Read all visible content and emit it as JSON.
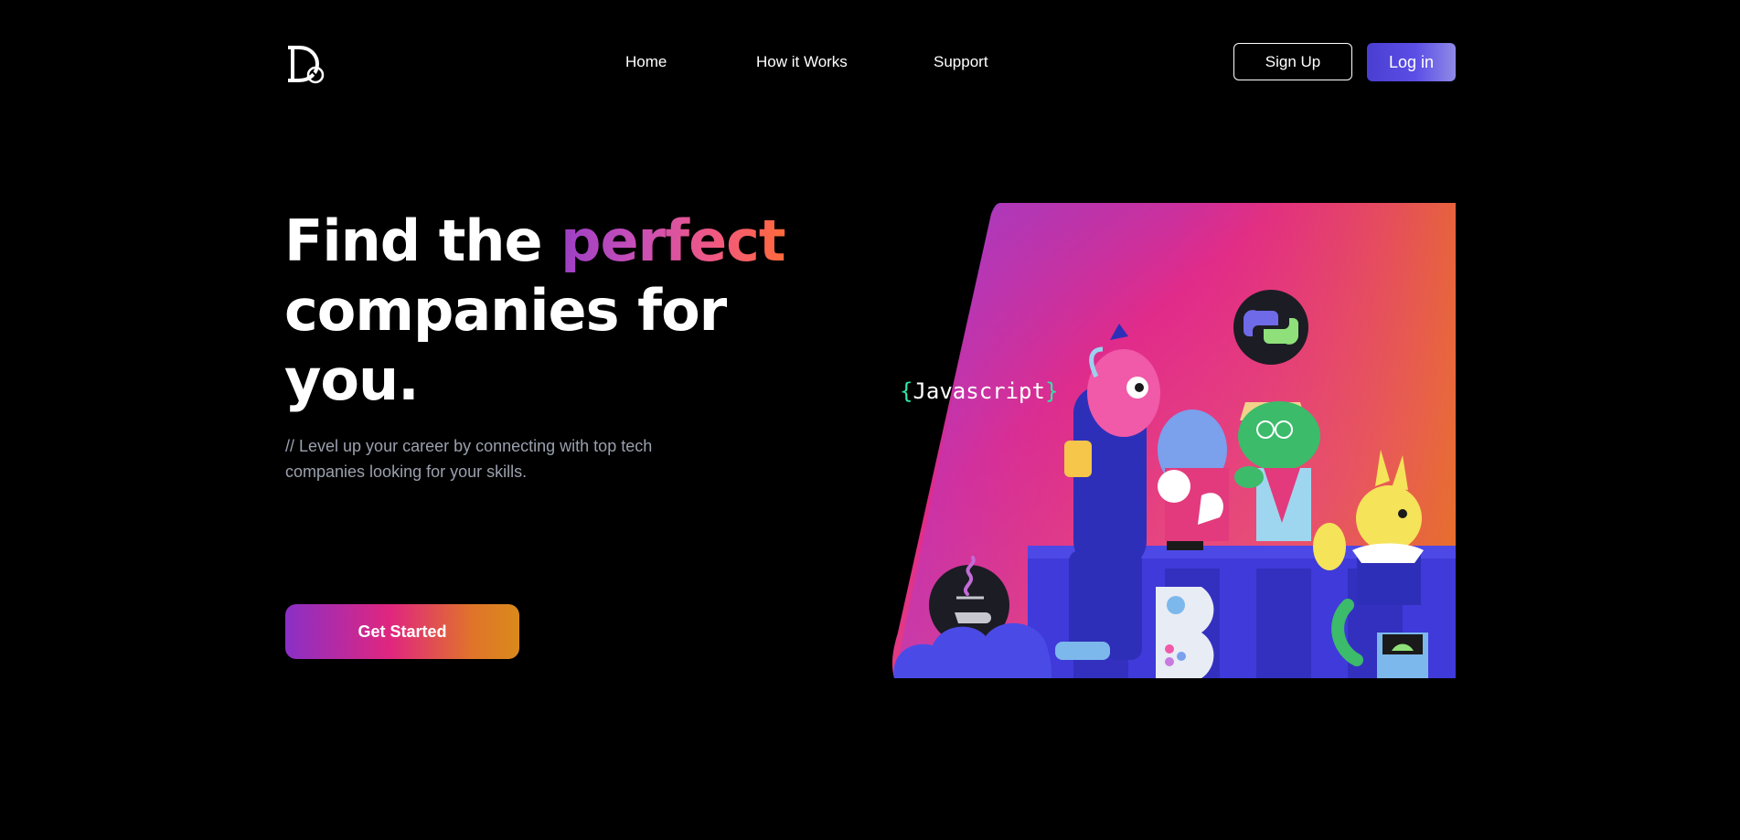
{
  "nav": {
    "logo_alt": "D",
    "links": [
      {
        "label": "Home"
      },
      {
        "label": "How it Works"
      },
      {
        "label": "Support"
      }
    ],
    "signup_label": "Sign Up",
    "login_label": "Log in"
  },
  "hero": {
    "headline_part1": "Find the ",
    "headline_accent": "perfect",
    "headline_part2": "companies for",
    "headline_part3": "you.",
    "subtext": "// Level up your career by connecting with top tech companies looking for your skills.",
    "cta_label": "Get Started"
  },
  "illustration": {
    "code_label_open": "{",
    "code_label_text": "Javascript",
    "code_label_close": "}",
    "icons": [
      "python-icon",
      "java-icon"
    ]
  },
  "colors": {
    "background": "#000000",
    "accent_purple": "#5b4ee6",
    "gradient_start": "#8a2fc7",
    "gradient_mid": "#e0267e",
    "gradient_end": "#e0742a"
  }
}
